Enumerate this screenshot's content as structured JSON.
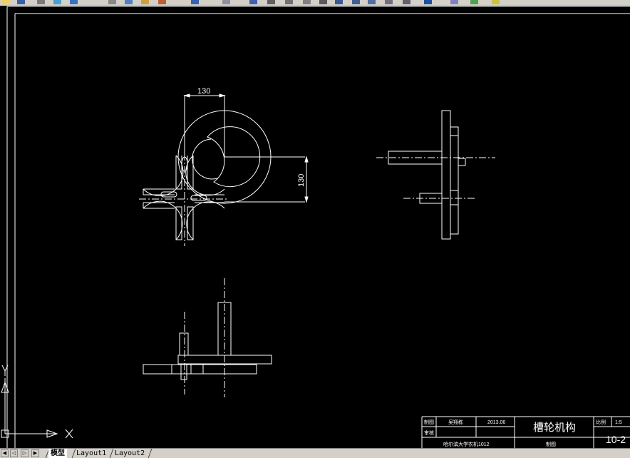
{
  "tabs": [
    {
      "label": "模型",
      "active": true
    },
    {
      "label": "Layout1",
      "active": false
    },
    {
      "label": "Layout2",
      "active": false
    }
  ],
  "nav_buttons": [
    "first-layout",
    "previous-layout",
    "next-layout",
    "last-layout"
  ],
  "drawing": {
    "dimension_horizontal": "130",
    "dimension_vertical": "130"
  },
  "title_block": {
    "title": "槽轮机构",
    "drawing_number": "10-2",
    "row1_label": "制图",
    "row1_name": "吴翔栋",
    "row1_date": "2013.06",
    "row2_label": "审核",
    "scale_label": "比例",
    "scale_value": "1:5",
    "school": "哈尔滨大学农机1012",
    "bottom_label": "制图"
  },
  "ucs": {
    "x_label": "X",
    "y_label": "Y"
  },
  "colors": {
    "background": "#000000",
    "lines": "#ffffff",
    "ui_gray": "#d4d0c8"
  }
}
